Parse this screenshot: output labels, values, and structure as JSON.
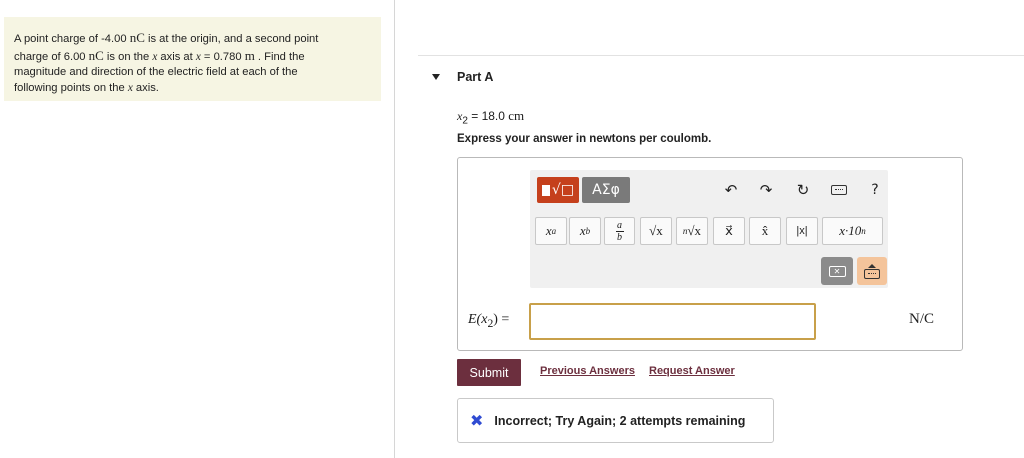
{
  "problem": {
    "line1_a": "A point charge of -4.00 ",
    "unit_nC": "nC",
    "line1_b": " is at the origin, and a second point",
    "line2_a": "charge of 6.00 ",
    "line2_b": " is on the ",
    "var_x": "x",
    "line2_c": "  axis at ",
    "line2_d": " = 0.780 ",
    "unit_m": "m",
    "line2_e": " . Find the",
    "line3": "magnitude and direction of the electric field at each of the",
    "line4_a": "following points on the ",
    "line4_b": " axis."
  },
  "part": {
    "title": "Part A"
  },
  "given": {
    "var": "x",
    "sub": "2",
    "eq": " = 18.0 ",
    "unit": "cm"
  },
  "instructions": "Express your answer in newtons per coulomb.",
  "toolbar": {
    "template_label": "√□",
    "greek_label": "ΑΣφ",
    "undo": "↶",
    "redo": "↷",
    "reset": "↻",
    "help": "?",
    "math_buttons": {
      "power_base": "x",
      "power_sup": "a",
      "sub_base": "x",
      "sub_sub": "b",
      "frac_num": "a",
      "frac_den": "b",
      "sqrt": "√x",
      "nroot_n": "n",
      "nroot": "√x",
      "vector": "x⃗",
      "unitvec": "x̂",
      "abs": "|x|",
      "sci": "x·10",
      "sci_sup": "n"
    },
    "backspace": "✕"
  },
  "answer": {
    "label_lead": "E(",
    "label_var": "x",
    "label_sub": "2",
    "label_tail": ") =",
    "value": "",
    "unit": "N/C"
  },
  "actions": {
    "submit": "Submit",
    "previous_answers": "Previous Answers",
    "request_answer": "Request Answer"
  },
  "feedback": {
    "icon": "✖",
    "text": "Incorrect; Try Again; 2 attempts remaining",
    "icon_color": "#2f4bd2"
  },
  "colors": {
    "submit_bg": "#6c2f3e",
    "template_btn": "#c5401c",
    "problem_bg": "#f6f5e3",
    "input_border": "#c8a04a"
  }
}
